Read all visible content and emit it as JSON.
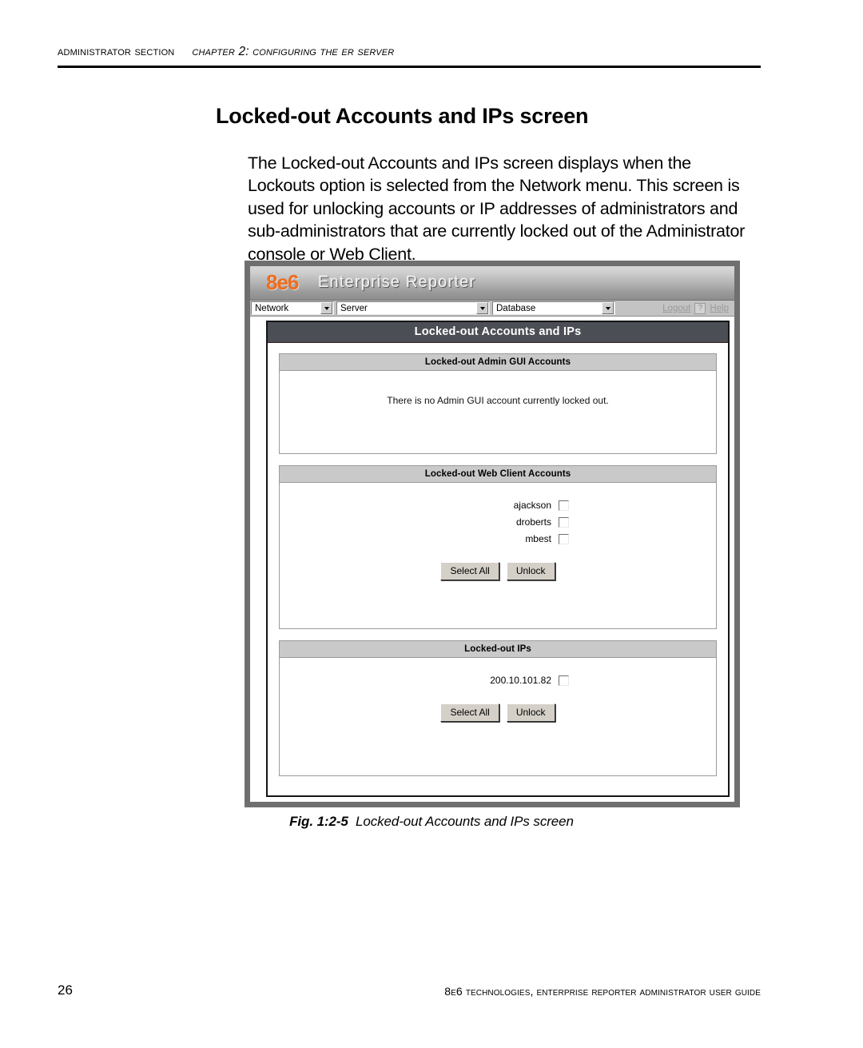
{
  "running_head": {
    "section": "Administrator Section",
    "chapter": "Chapter 2: Configuring the ER Server"
  },
  "headline": "Locked-out Accounts and IPs screen",
  "intro_paragraph": "The Locked-out Accounts and IPs screen displays when the Lockouts option is selected from the Network menu. This screen is used for unlocking accounts or IP addresses of administrators and sub-administrators that are currently locked out of the Administrator console or Web Client.",
  "figure": {
    "app": {
      "logo_mark": "8e6",
      "logo_name": "Enterprise Reporter",
      "menu": {
        "dropdowns": [
          {
            "label": "Network"
          },
          {
            "label": "Server"
          },
          {
            "label": "Database"
          }
        ],
        "logout_label": "Logout",
        "help_icon": "?",
        "help_label": "Help"
      }
    },
    "screen_title": "Locked-out Accounts and IPs",
    "panels": [
      {
        "id": "admin-gui",
        "header": "Locked-out Admin GUI Accounts",
        "empty_message": "There is no Admin GUI account currently locked out."
      },
      {
        "id": "web-client",
        "header": "Locked-out Web Client Accounts",
        "rows": [
          {
            "label": "ajackson",
            "checked": false
          },
          {
            "label": "droberts",
            "checked": false
          },
          {
            "label": "mbest",
            "checked": false
          }
        ],
        "buttons": {
          "select_all": "Select All",
          "unlock": "Unlock"
        }
      },
      {
        "id": "locked-ips",
        "header": "Locked-out IPs",
        "rows": [
          {
            "label": "200.10.101.82",
            "checked": false
          }
        ],
        "buttons": {
          "select_all": "Select All",
          "unlock": "Unlock"
        }
      }
    ]
  },
  "caption": {
    "number": "Fig. 1:2-5",
    "title": "Locked-out Accounts and IPs screen"
  },
  "footer": {
    "page_number": "26",
    "text": "8e6 Technologies, Enterprise Reporter Administrator User Guide"
  },
  "colors": {
    "accent_orange": "#ef6c1f",
    "title_bar": "#4b4e55",
    "panel_header": "#c9c9c9",
    "frame_gray": "#6f6f6f"
  }
}
